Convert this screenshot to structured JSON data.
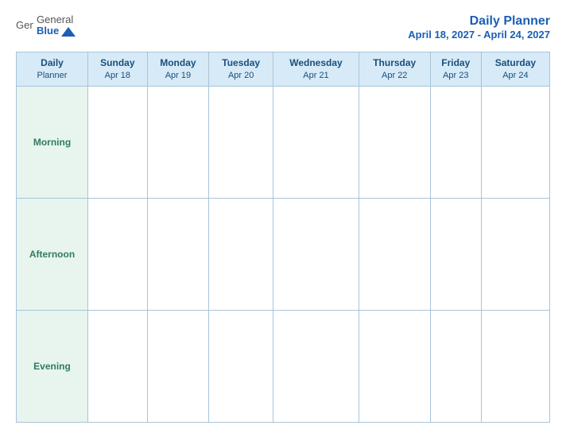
{
  "header": {
    "logo": {
      "general": "General",
      "blue": "Blue"
    },
    "title": "Daily Planner",
    "date_range": "April 18, 2027 - April 24, 2027"
  },
  "table": {
    "header_label_line1": "Daily",
    "header_label_line2": "Planner",
    "columns": [
      {
        "day": "Sunday",
        "date": "Apr 18"
      },
      {
        "day": "Monday",
        "date": "Apr 19"
      },
      {
        "day": "Tuesday",
        "date": "Apr 20"
      },
      {
        "day": "Wednesday",
        "date": "Apr 21"
      },
      {
        "day": "Thursday",
        "date": "Apr 22"
      },
      {
        "day": "Friday",
        "date": "Apr 23"
      },
      {
        "day": "Saturday",
        "date": "Apr 24"
      }
    ],
    "rows": [
      {
        "label": "Morning"
      },
      {
        "label": "Afternoon"
      },
      {
        "label": "Evening"
      }
    ]
  }
}
